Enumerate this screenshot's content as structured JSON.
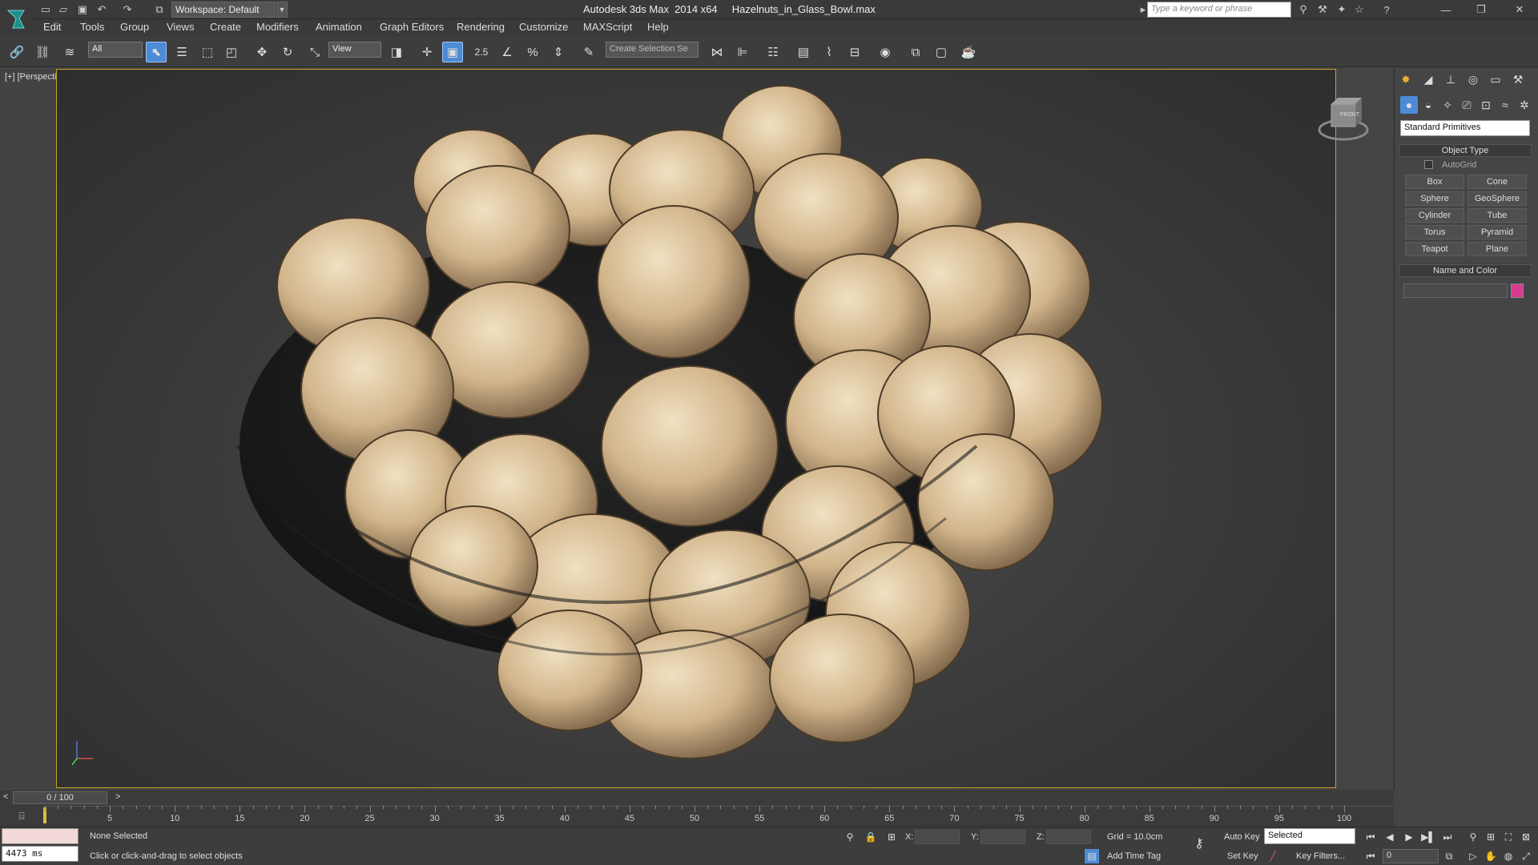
{
  "titlebar": {
    "workspace": "Workspace: Default",
    "title": "Autodesk 3ds Max  2014 x64     Hazelnuts_in_Glass_Bowl.max",
    "search_placeholder": "Type a keyword or phrase"
  },
  "menu": [
    "Edit",
    "Tools",
    "Group",
    "Views",
    "Create",
    "Modifiers",
    "Animation",
    "Graph Editors",
    "Rendering",
    "Customize",
    "MAXScript",
    "Help"
  ],
  "toolbar": {
    "selection_filter": "All",
    "ref_coord": "View",
    "snaps_label": "2.5",
    "named_selection": "Create Selection Se"
  },
  "viewport": {
    "label": "[+] [Perspective ] [Shaded]",
    "viewcube_label": "FRONT"
  },
  "command_panel": {
    "category": "Standard Primitives",
    "object_type_header": "Object Type",
    "autogrid": "AutoGrid",
    "buttons": [
      "Box",
      "Cone",
      "Sphere",
      "GeoSphere",
      "Cylinder",
      "Tube",
      "Torus",
      "Pyramid",
      "Teapot",
      "Plane"
    ],
    "name_color_header": "Name and Color",
    "object_color": "#d63c8f"
  },
  "timeline": {
    "frame_display": "0 / 100",
    "ticks": [
      "5",
      "10",
      "15",
      "20",
      "25",
      "30",
      "35",
      "40",
      "45",
      "50",
      "55",
      "60",
      "65",
      "70",
      "75",
      "80",
      "85",
      "90",
      "95",
      "100"
    ]
  },
  "status": {
    "selection": "None Selected",
    "prompt": "Click or click-and-drag to select objects",
    "render_time": "4473 ms",
    "x_label": "X:",
    "y_label": "Y:",
    "z_label": "Z:",
    "grid": "Grid = 10.0cm",
    "add_time_tag": "Add Time Tag",
    "auto_key": "Auto Key",
    "set_key": "Set Key",
    "key_mode": "Selected",
    "key_filters": "Key Filters...",
    "current_frame": "0"
  }
}
